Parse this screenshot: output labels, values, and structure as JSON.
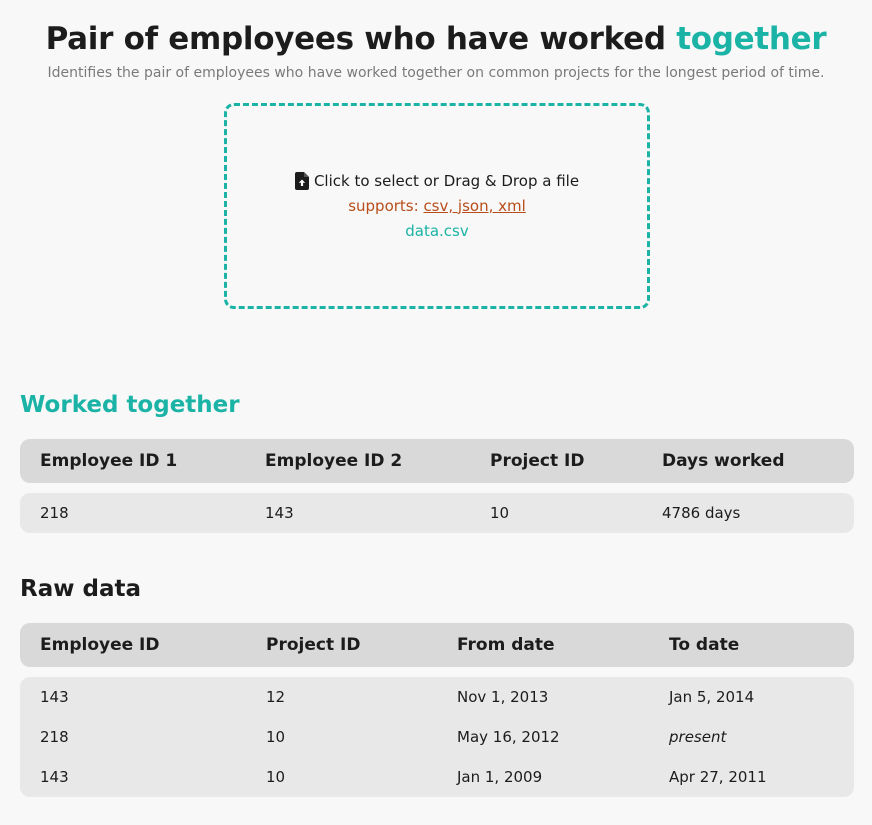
{
  "header": {
    "title_main": "Pair of employees who have worked ",
    "title_accent": "together",
    "subtitle": "Identifies the pair of employees who have worked together on common projects for the longest period of time."
  },
  "dropzone": {
    "icon": "file-upload-icon",
    "prompt": "Click to select or Drag & Drop a file",
    "supports_label": "supports: ",
    "supports_formats": "csv, json, xml",
    "selected_file": "data.csv"
  },
  "worked_together": {
    "title": "Worked together",
    "columns": [
      "Employee ID 1",
      "Employee ID 2",
      "Project ID",
      "Days worked"
    ],
    "rows": [
      [
        "218",
        "143",
        "10",
        "4786 days"
      ]
    ]
  },
  "raw_data": {
    "title": "Raw data",
    "columns": [
      "Employee ID",
      "Project ID",
      "From date",
      "To date"
    ],
    "rows": [
      [
        "143",
        "12",
        "Nov 1, 2013",
        "Jan 5, 2014"
      ],
      [
        "218",
        "10",
        "May 16, 2012",
        "present"
      ],
      [
        "143",
        "10",
        "Jan 1, 2009",
        "Apr 27, 2011"
      ]
    ]
  },
  "colors": {
    "accent": "#1ab3a6",
    "supports": "#b84d1a",
    "header_row": "#d9d9d9",
    "body_row": "#e8e8e8"
  }
}
